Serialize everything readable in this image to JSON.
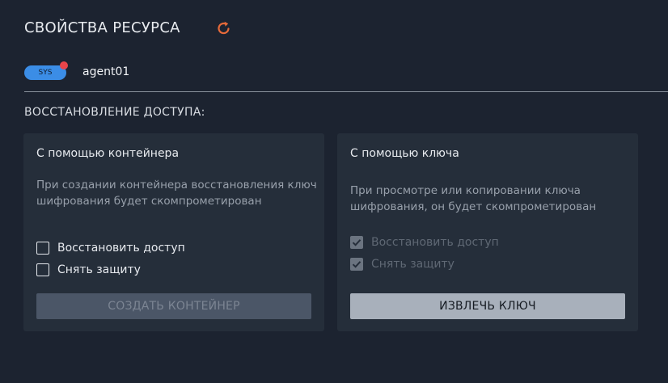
{
  "header": {
    "title": "СВОЙСТВА РЕСУРСА",
    "refresh_icon": "refresh-icon",
    "accent_color": "#e66a3a"
  },
  "resource": {
    "badge": "SYS",
    "badge_color": "#3b8de6",
    "status_dot_color": "#e8454a",
    "name": "agent01"
  },
  "section": {
    "title": "ВОССТАНОВЛЕНИЕ ДОСТУПА:"
  },
  "container_card": {
    "title": "С помощью контейнера",
    "description": "При создании контейнера восстановления ключ шифрования будет скомпрометирован",
    "options": [
      {
        "label": "Восстановить доступ",
        "checked": false
      },
      {
        "label": "Снять защиту",
        "checked": false
      }
    ],
    "button": "СОЗДАТЬ КОНТЕЙНЕР",
    "button_enabled": false
  },
  "key_card": {
    "title": "С помощью ключа",
    "description": "При просмотре или копировании ключа шифрования, он будет скомпрометирован",
    "options": [
      {
        "label": "Восстановить доступ",
        "checked": true,
        "disabled": true
      },
      {
        "label": "Снять защиту",
        "checked": true,
        "disabled": true
      }
    ],
    "button": "ИЗВЛЕЧЬ КЛЮЧ",
    "button_enabled": true
  }
}
